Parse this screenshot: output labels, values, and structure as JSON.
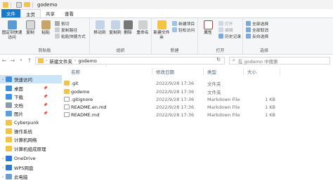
{
  "window": {
    "title": "godemo"
  },
  "tabs": [
    "文件",
    "主页",
    "共享",
    "查看"
  ],
  "ribbon": {
    "clipboard": {
      "group_label": "剪贴板",
      "pin_label": "固定到快速访问",
      "copy_label": "复制",
      "paste_label": "粘贴",
      "cut_label": "剪切",
      "copy_path_label": "复制路径",
      "paste_shortcut_label": "粘贴快捷方式"
    },
    "organize": {
      "group_label": "组织",
      "move_label": "移动到",
      "copy_to_label": "复制到",
      "delete_label": "删除",
      "rename_label": "重命名"
    },
    "new": {
      "group_label": "新建",
      "new_folder_label": "新建文件夹",
      "new_item_label": "新建项目",
      "easy_access_label": "轻松访问"
    },
    "open": {
      "group_label": "打开",
      "properties_label": "属性",
      "open_label": "打开",
      "edit_label": "编辑",
      "history_label": "历史记录"
    },
    "select": {
      "group_label": "选择",
      "select_all_label": "全部选择",
      "select_none_label": "全部取消",
      "invert_label": "反向选择"
    }
  },
  "address": {
    "crumbs": [
      "新建文件夹",
      "godemo"
    ],
    "search_placeholder": "在 godemo 中搜索"
  },
  "nav": {
    "items": [
      {
        "label": "快速访问",
        "icon": "star-icon",
        "pinned": false
      },
      {
        "label": "桌面",
        "icon": "desktop-icon",
        "pinned": true
      },
      {
        "label": "下载",
        "icon": "download-icon",
        "pinned": true
      },
      {
        "label": "文档",
        "icon": "document-icon",
        "pinned": true
      },
      {
        "label": "图片",
        "icon": "picture-icon",
        "pinned": true
      },
      {
        "label": "Cyberpunk",
        "icon": "folder-icon",
        "pinned": false
      },
      {
        "label": "操作系统",
        "icon": "folder-icon",
        "pinned": false
      },
      {
        "label": "计算机网络",
        "icon": "folder-icon",
        "pinned": false
      },
      {
        "label": "计算机组成原理",
        "icon": "folder-icon",
        "pinned": false
      },
      {
        "label": "OneDrive",
        "icon": "cloud-icon",
        "pinned": false
      },
      {
        "label": "WPS网盘",
        "icon": "cloud-icon",
        "pinned": false
      },
      {
        "label": "此电脑",
        "icon": "computer-icon",
        "pinned": false
      }
    ]
  },
  "columns": {
    "name": "名称",
    "date": "修改日期",
    "type": "类型",
    "size": "大小"
  },
  "files": [
    {
      "name": ".git",
      "date": "2022/9/28 17:36",
      "type": "文件夹",
      "size": "",
      "kind": "folder"
    },
    {
      "name": "godemo",
      "date": "2022/9/28 17:36",
      "type": "文件夹",
      "size": "",
      "kind": "folder"
    },
    {
      "name": ".gitignore",
      "date": "2022/9/28 17:36",
      "type": "Markdown File",
      "size": "1 KB",
      "kind": "file"
    },
    {
      "name": "README.en.md",
      "date": "2022/9/28 17:36",
      "type": "Markdown File",
      "size": "1 KB",
      "kind": "file"
    },
    {
      "name": "README.md",
      "date": "2022/9/28 17:36",
      "type": "Markdown File",
      "size": "1 KB",
      "kind": "file"
    }
  ],
  "colors": {
    "accent": "#1979ca",
    "folder": "#f3c441",
    "selection": "#cce4f7"
  }
}
